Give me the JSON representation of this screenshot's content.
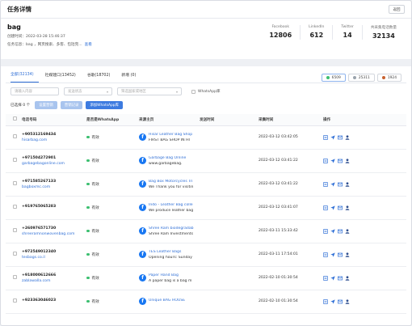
{
  "header": {
    "title": "任务详情",
    "back_label": "返回"
  },
  "task": {
    "name": "bag",
    "created_label": "创建时间：",
    "created_value": "2022-03-28 15:46:37",
    "info_label": "任务信息：",
    "info_value": "bag ，网页搜索、多客、包括完...",
    "view_link": "查看"
  },
  "stats": [
    {
      "label": "Facebook",
      "value": "12806"
    },
    {
      "label": "LinkedIn",
      "value": "612"
    },
    {
      "label": "Twitter",
      "value": "14"
    },
    {
      "label": "共采集电话数量",
      "value": "32134"
    }
  ],
  "tabs": [
    {
      "label": "全部(32134)",
      "active": true
    },
    {
      "label": "社媒建口(13452)",
      "active": false
    },
    {
      "label": "谷歌(18702)",
      "active": false
    },
    {
      "label": "新增 (0)",
      "active": false
    }
  ],
  "chips": [
    {
      "value": "6509",
      "color": "#3cbf70"
    },
    {
      "value": "25311",
      "color": "#9aa3ad"
    },
    {
      "value": "1924",
      "color": "#c8612f"
    }
  ],
  "filters": {
    "keyword_placeholder": "请输入内容",
    "status_placeholder": "发送状态",
    "region_placeholder": "筛选国家或地区",
    "whatsapp_label": "WhatsApp库"
  },
  "actions": {
    "selected_label": "已选择 0 个",
    "btn1": "设置营销",
    "btn2": "营销记录",
    "btn3": "添加WhatsApp库"
  },
  "columns": {
    "phone": "电话号码",
    "whatsapp": "是否是WhatsApp",
    "source": "来源主页",
    "send_time": "发送时间",
    "collect_time": "采集时间",
    "ops": "操作"
  },
  "rows": [
    {
      "phone": "+905312169434",
      "site": "hisarbag.com",
      "wa": "有效",
      "src_title": "Hisar Leather Bag Shop",
      "src_desc": "FIRST BAG SHOP IN HI",
      "send": "",
      "time": "2022-03-12 03:42:05"
    },
    {
      "phone": "+971504272901",
      "site": "garbagebagonline.com",
      "wa": "有效",
      "src_title": "Garbage Bag Online",
      "src_desc": "www.garbagebag.",
      "send": "",
      "time": "2022-03-12 03:41:22"
    },
    {
      "phone": "+971585267133",
      "site": "bagboxmc.com",
      "wa": "有效",
      "src_title": "Bag Box Motorcycles Tri",
      "src_desc": "We Thank you for visitin",
      "send": "",
      "time": "2022-03-12 03:41:22"
    },
    {
      "phone": "+919765065283",
      "site": "",
      "wa": "有效",
      "src_title": "Indo - Leather Bag colle",
      "src_desc": "We produce leather bag",
      "send": "",
      "time": "2022-03-12 03:41:07"
    },
    {
      "phone": "+260976571730",
      "site": "shreeramnonwovenbag.com",
      "wa": "有效",
      "src_title": "Shree Ram biodegradab",
      "src_desc": "Shree Ram Investments",
      "send": "",
      "time": "2022-03-11 15:33:42"
    },
    {
      "phone": "+972549012340",
      "site": "tesbags.co.il",
      "wa": "有效",
      "src_title": "TES Leather Bags",
      "src_desc": "Opening hours: Sunday",
      "send": "",
      "time": "2022-03-11 17:54:01"
    },
    {
      "phone": "+918000612666",
      "site": "zablawalla.com",
      "wa": "有效",
      "src_title": "Paper Hand Bag",
      "src_desc": "A paper bag is a bag m",
      "send": "",
      "time": "2022-02-10 01:30:54"
    },
    {
      "phone": "+923363046023",
      "site": "",
      "wa": "有效",
      "src_title": "Unique BAG HOUSE",
      "src_desc": "",
      "send": "",
      "time": "2022-02-10 01:30:54"
    }
  ]
}
